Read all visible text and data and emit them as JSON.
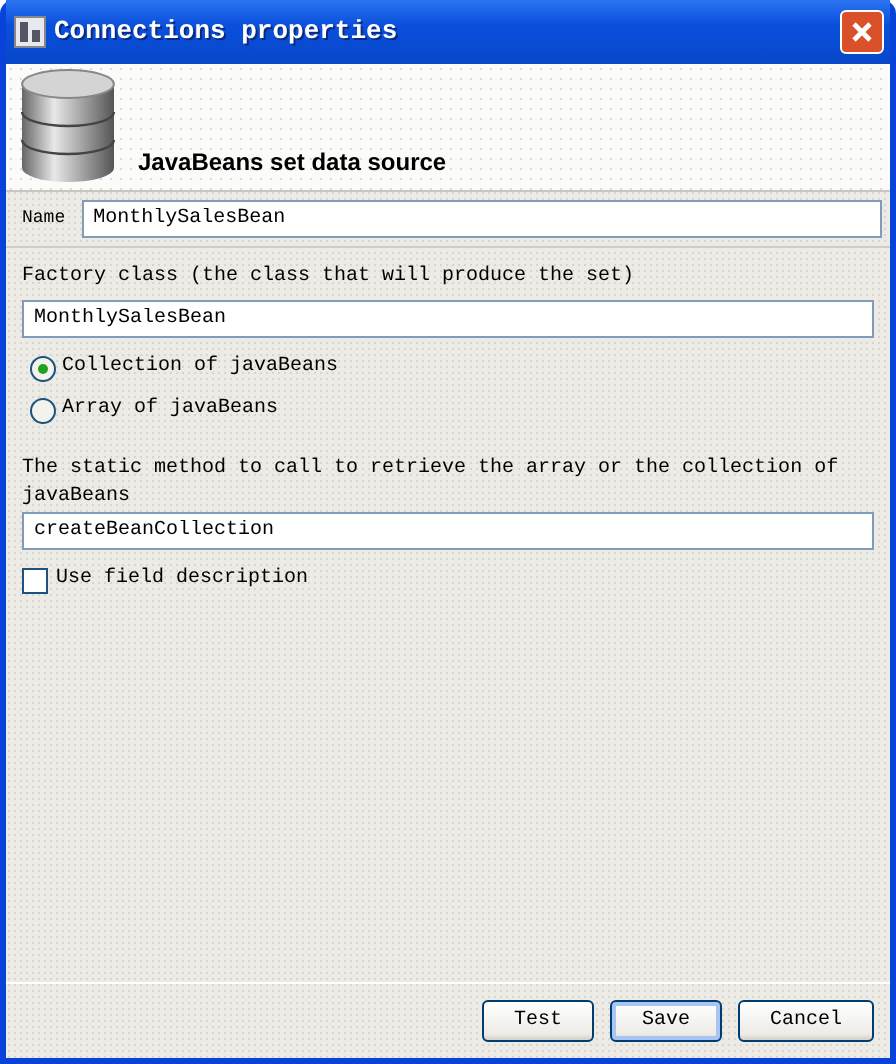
{
  "window": {
    "title": "Connections properties"
  },
  "header": {
    "title": "JavaBeans set data source"
  },
  "name_field": {
    "label": "Name",
    "value": "MonthlySalesBean"
  },
  "factory_class": {
    "label": "Factory class (the class that will produce the set)",
    "value": "MonthlySalesBean"
  },
  "options": [
    {
      "label": "Collection of javaBeans",
      "selected": true
    },
    {
      "label": "Array of javaBeans",
      "selected": false
    }
  ],
  "method": {
    "label": "The static method to call to retrieve the array or the collection of javaBeans",
    "value": "createBeanCollection"
  },
  "use_field_description": {
    "label": "Use field description",
    "checked": false
  },
  "buttons": [
    {
      "label": "Test",
      "default": false
    },
    {
      "label": "Save",
      "default": true
    },
    {
      "label": "Cancel",
      "default": false
    }
  ]
}
